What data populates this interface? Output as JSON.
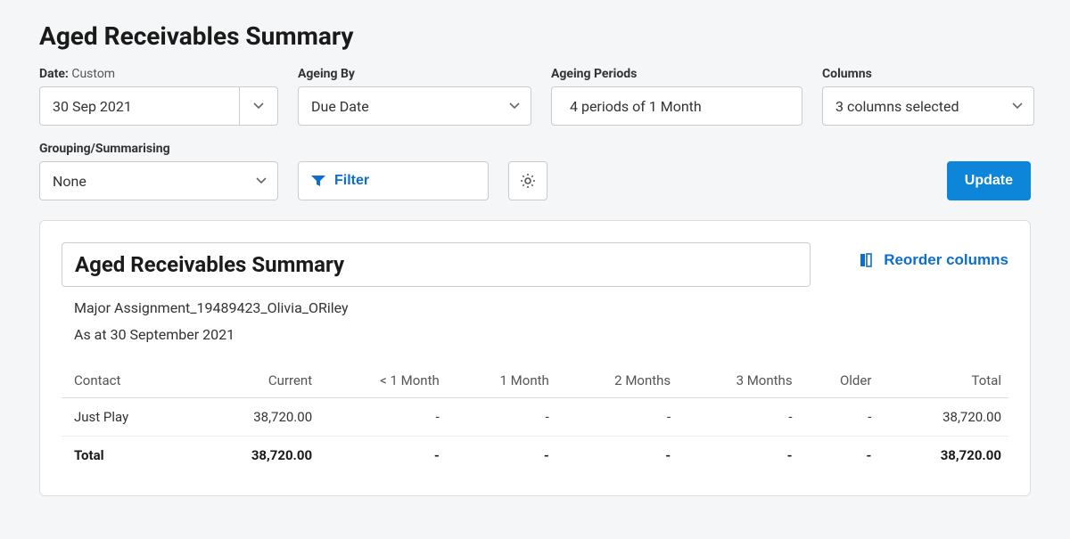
{
  "page_title": "Aged Receivables Summary",
  "filters": {
    "date": {
      "label": "Date:",
      "suffix": "Custom",
      "value": "30 Sep 2021"
    },
    "ageing_by": {
      "label": "Ageing By",
      "value": "Due Date"
    },
    "ageing_periods": {
      "label": "Ageing Periods",
      "value": "4 periods of 1 Month"
    },
    "columns": {
      "label": "Columns",
      "value": "3 columns selected"
    },
    "grouping": {
      "label": "Grouping/Summarising",
      "value": "None"
    },
    "filter_button": "Filter",
    "update_button": "Update"
  },
  "report": {
    "title": "Aged Receivables Summary",
    "reorder_label": "Reorder columns",
    "org": "Major Assignment_19489423_Olivia_ORiley",
    "as_at": "As at 30 September 2021",
    "columns": [
      "Contact",
      "Current",
      "< 1 Month",
      "1 Month",
      "2 Months",
      "3 Months",
      "Older",
      "Total"
    ],
    "rows": [
      {
        "contact": "Just Play",
        "current": "38,720.00",
        "lt1m": "-",
        "m1": "-",
        "m2": "-",
        "m3": "-",
        "older": "-",
        "total": "38,720.00"
      }
    ],
    "total_row": {
      "contact": "Total",
      "current": "38,720.00",
      "lt1m": "-",
      "m1": "-",
      "m2": "-",
      "m3": "-",
      "older": "-",
      "total": "38,720.00"
    }
  }
}
